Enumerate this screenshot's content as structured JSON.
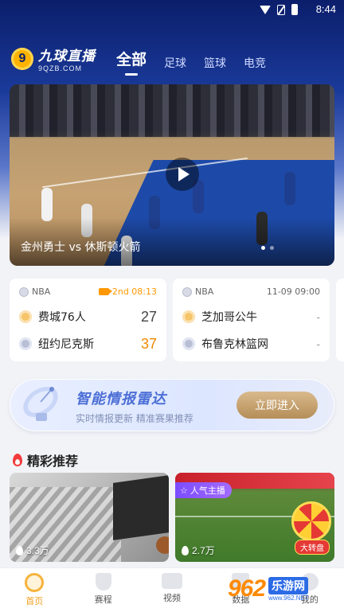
{
  "status_bar": {
    "time": "8:44"
  },
  "app": {
    "name": "九球直播",
    "url": "9QZB.COM",
    "badge": "9"
  },
  "tabs": [
    {
      "label": "全部",
      "active": true
    },
    {
      "label": "足球",
      "active": false
    },
    {
      "label": "篮球",
      "active": false
    },
    {
      "label": "电竞",
      "active": false
    }
  ],
  "hero": {
    "title": "金州勇士 vs 休斯顿火箭",
    "slide_count": 2,
    "active_slide": 1
  },
  "matches": [
    {
      "league": "NBA",
      "status": "2nd 08:13",
      "live": true,
      "home": {
        "name": "费城76人",
        "score": "27"
      },
      "away": {
        "name": "纽约尼克斯",
        "score": "37"
      }
    },
    {
      "league": "NBA",
      "status": "11-09 09:00",
      "live": false,
      "home": {
        "name": "芝加哥公牛",
        "score": "-"
      },
      "away": {
        "name": "布鲁克林篮网",
        "score": "-"
      }
    }
  ],
  "radar": {
    "title": "智能情报雷达",
    "subtitle": "实时情报更新 精准赛果推荐",
    "button": "立即进入"
  },
  "featured": {
    "title": "精彩推荐",
    "items": [
      {
        "viewers": "3.3万",
        "badge": ""
      },
      {
        "viewers": "2.7万",
        "badge": "人气主播",
        "overlay": "大转盘"
      }
    ]
  },
  "bottom_nav": [
    {
      "label": "首页",
      "icon": "home-icon",
      "active": true
    },
    {
      "label": "赛程",
      "icon": "trophy-icon",
      "active": false
    },
    {
      "label": "视频",
      "icon": "video-icon",
      "active": false
    },
    {
      "label": "数据",
      "icon": "data-icon",
      "active": false
    },
    {
      "label": "我的",
      "icon": "profile-icon",
      "active": false
    }
  ],
  "watermark": {
    "number": "962",
    "text": "乐游网",
    "url": "www.962.NET"
  },
  "colors": {
    "brand_dark": "#0b1e6b",
    "accent": "#f0a020",
    "win_score": "#f08a00"
  }
}
